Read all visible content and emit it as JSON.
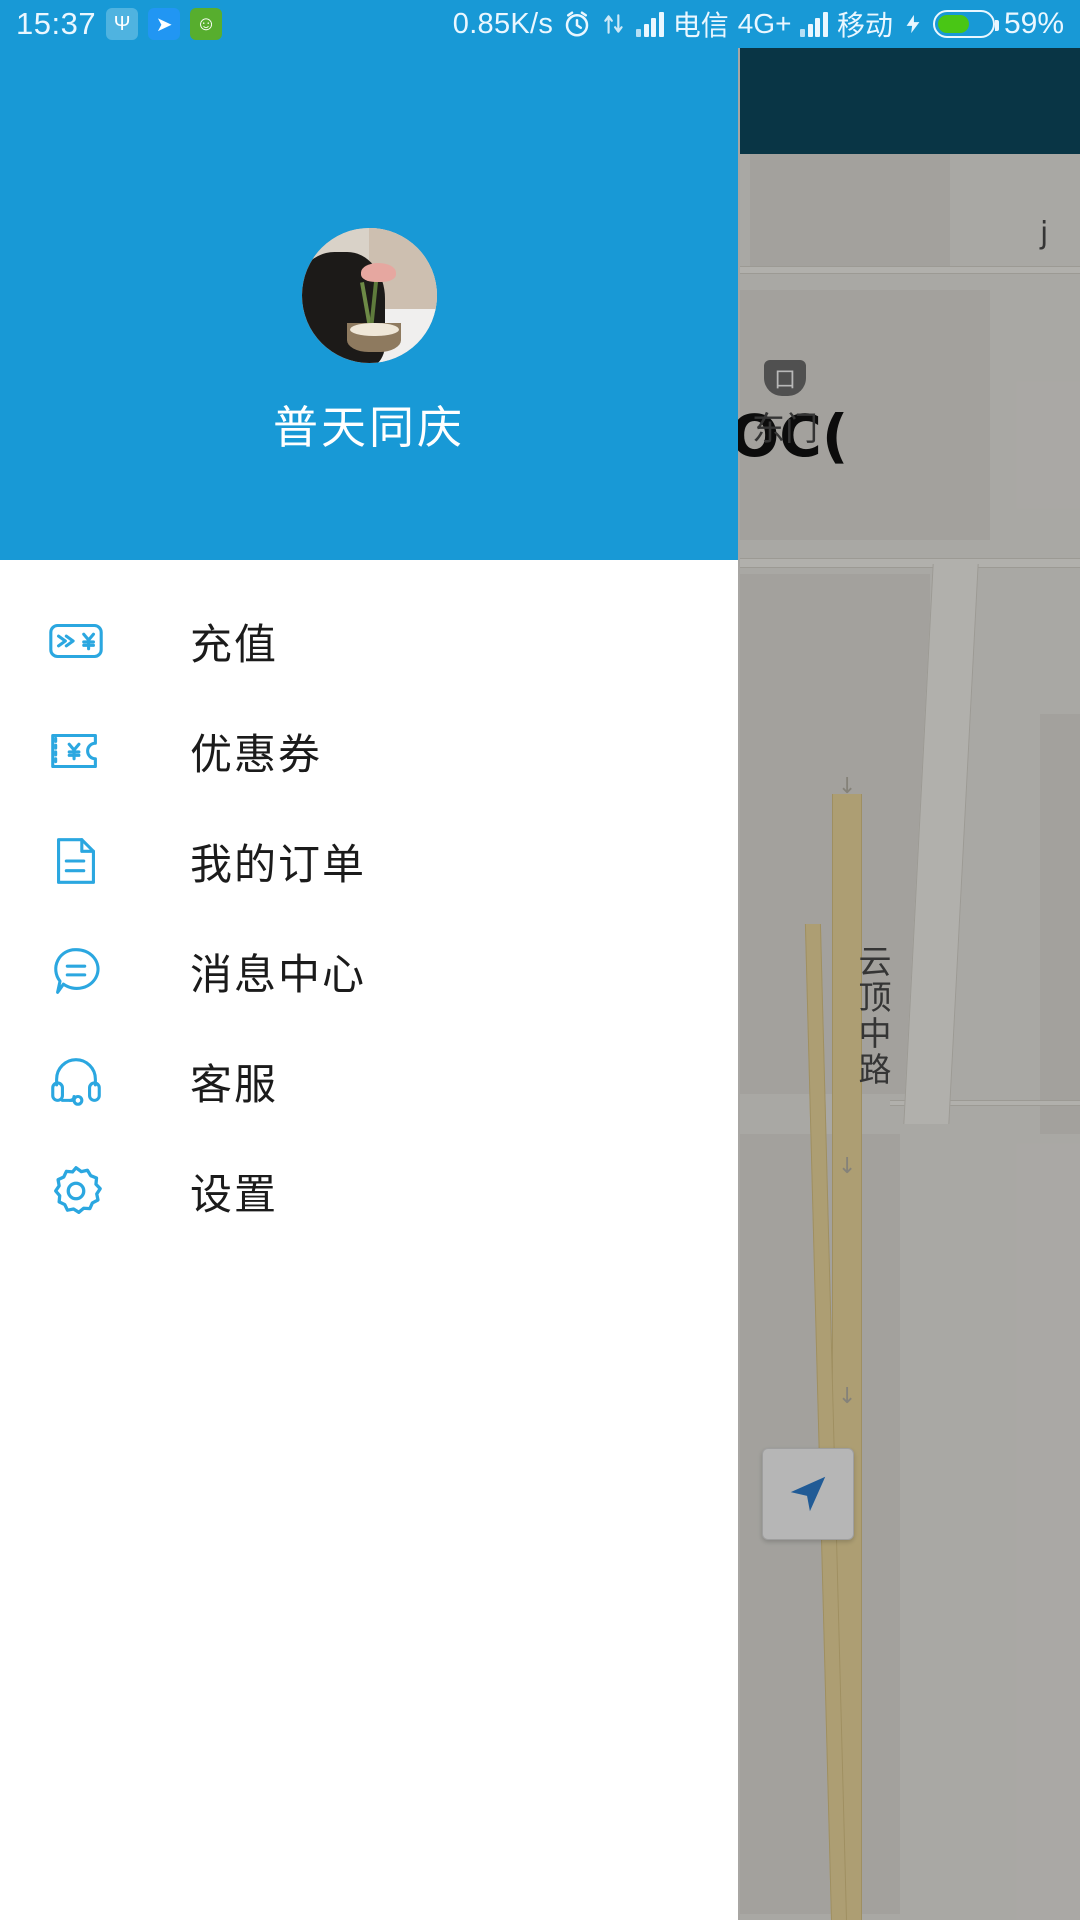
{
  "status_bar": {
    "time": "15:37",
    "icons": [
      {
        "name": "usb-icon",
        "glyph": "Ψ"
      },
      {
        "name": "paper-plane-icon",
        "glyph": "➤"
      },
      {
        "name": "robot-face-icon",
        "glyph": "☺"
      }
    ],
    "network_speed": "0.85K/s",
    "alarm_icon": "alarm-clock-icon",
    "data_transfer_icon": "data-updown-icon",
    "carrier_1": "电信",
    "network_type_1": "4G+",
    "carrier_2": "移动",
    "charging_icon": "lightning-bolt-icon",
    "battery_percent": "59%",
    "battery_level": 59,
    "battery_color": "#49c615"
  },
  "drawer": {
    "header_color": "#1899d6",
    "avatar": "user-avatar-photo",
    "username": "普天同庆",
    "menu": [
      {
        "label": "充值",
        "icon": "recharge-card-icon"
      },
      {
        "label": "优惠券",
        "icon": "coupon-ticket-icon"
      },
      {
        "label": "我的订单",
        "icon": "order-document-icon"
      },
      {
        "label": "消息中心",
        "icon": "message-bubble-icon"
      },
      {
        "label": "客服",
        "icon": "headset-support-icon"
      },
      {
        "label": "设置",
        "icon": "settings-gear-icon"
      }
    ],
    "icon_color": "#2ba7e0"
  },
  "map": {
    "labels": {
      "poi_partial": "OC(",
      "gate": "东门",
      "road_vertical": "云顶中路",
      "marker_small": "j",
      "poi_badge_glyph": "口"
    },
    "locate_button": "my-location-button"
  }
}
